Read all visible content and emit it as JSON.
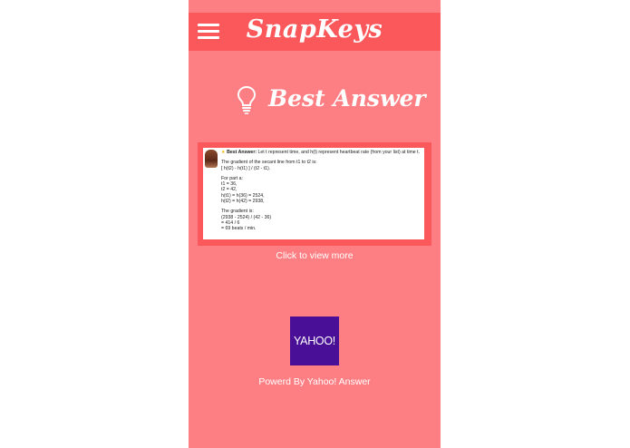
{
  "app": {
    "title": "SnapKeys"
  },
  "section": {
    "title": "Best Answer",
    "icon": "lightbulb-icon"
  },
  "answer": {
    "label": "Best Answer:",
    "intro": "Let t represent time, and h(t) represent heartbeat rate (from your list) at time t.",
    "lines": [
      "The gradient of the secant line from t1 to t2 is:",
      "[ h(t2) - h(t1) ] / (t2 - t1).",
      "",
      "For part a:",
      "t1 = 36,",
      "t2 = 42,",
      "h(t1) = h(36) = 2524,",
      "h(t2) = h(42) = 2938,",
      "",
      "The gradient is:",
      "(2938 - 2524) / (42 - 36)",
      "= 414 / 6",
      "= 69 beats / min."
    ]
  },
  "view_more": "Click to view more",
  "logo": {
    "text": "YAHOO!"
  },
  "powered_by": "Powerd By Yahoo! Answer",
  "colors": {
    "background": "#fe7f83",
    "header": "#fb585c",
    "logo": "#4a0f97",
    "text": "#ffffff"
  }
}
